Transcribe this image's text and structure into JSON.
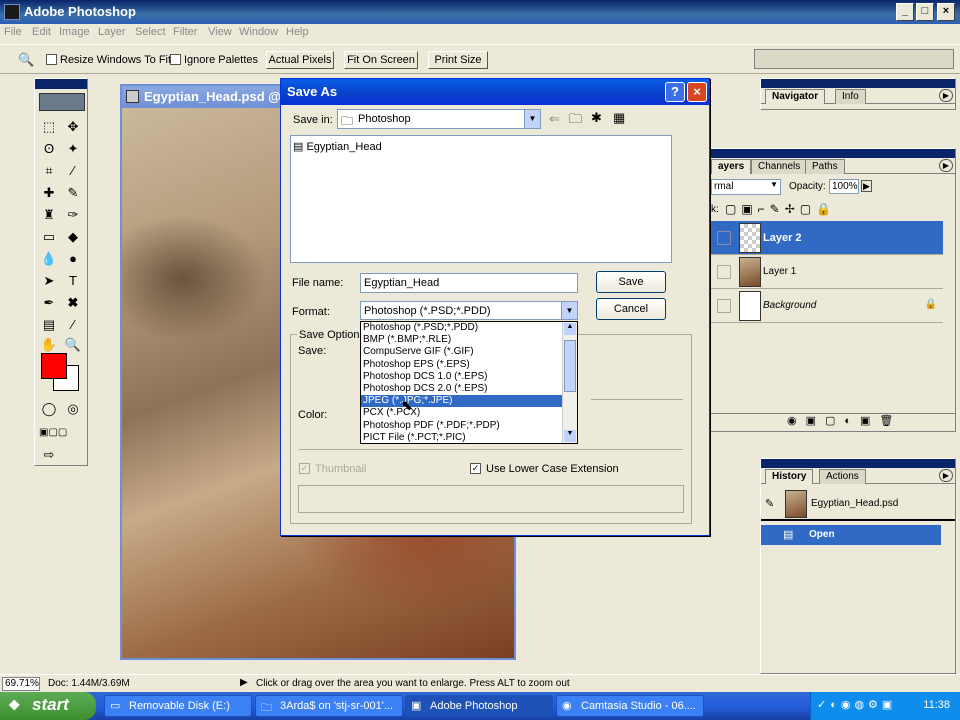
{
  "app": {
    "title": "Adobe Photoshop"
  },
  "menu": [
    "File",
    "Edit",
    "Image",
    "Layer",
    "Select",
    "Filter",
    "View",
    "Window",
    "Help"
  ],
  "options": {
    "resize_label": "Resize Windows To Fit",
    "ignore_label": "Ignore Palettes",
    "actual_pixels": "Actual Pixels",
    "fit_on_screen": "Fit On Screen",
    "print_size": "Print Size"
  },
  "document": {
    "title": "Egyptian_Head.psd @ 6"
  },
  "navigator": {
    "tabs": [
      "Navigator",
      "Info"
    ]
  },
  "layers": {
    "tabs": [
      "ayers",
      "Channels",
      "Paths"
    ],
    "blend_mode": "rmal",
    "opacity_label": "Opacity:",
    "opacity_value": "100%",
    "lock_label": "k:",
    "rows": [
      {
        "name": "Layer 2",
        "selected": true
      },
      {
        "name": "Layer 1",
        "selected": false
      },
      {
        "name": "Background",
        "selected": false
      }
    ]
  },
  "history": {
    "tabs": [
      "History",
      "Actions"
    ],
    "snapshot": "Egyptian_Head.psd",
    "step": "Open"
  },
  "dialog": {
    "title": "Save As",
    "save_in_label": "Save in:",
    "save_in_value": "Photoshop",
    "files": [
      "Egyptian_Head"
    ],
    "filename_label": "File name:",
    "filename_value": "Egyptian_Head",
    "format_label": "Format:",
    "format_value": "Photoshop (*.PSD;*.PDD)",
    "save_button": "Save",
    "cancel_button": "Cancel",
    "save_options_label": "Save Options",
    "save_label": "Save:",
    "color_label": "Color:",
    "thumbnail_label": "Thumbnail",
    "lowercase_label": "Use Lower Case Extension",
    "format_options": [
      "Photoshop (*.PSD;*.PDD)",
      "BMP (*.BMP;*.RLE)",
      "CompuServe GIF (*.GIF)",
      "Photoshop EPS (*.EPS)",
      "Photoshop DCS 1.0 (*.EPS)",
      "Photoshop DCS 2.0 (*.EPS)",
      "JPEG (*.JPG;*.JPE)",
      "PCX (*.PCX)",
      "Photoshop PDF (*.PDF;*.PDP)",
      "PICT File (*.PCT;*.PIC)"
    ],
    "highlighted_option_index": 6
  },
  "status": {
    "zoom": "69.71%",
    "doc": "Doc: 1.44M/3.69M",
    "hint": "Click or drag over the area you want to enlarge. Press ALT to zoom out"
  },
  "taskbar": {
    "start": "start",
    "tasks": [
      "Removable Disk (E:)",
      "3Arda$ on 'stj-sr-001'...",
      "Adobe Photoshop",
      "Camtasia Studio - 06...."
    ],
    "active_index": 2,
    "clock": "11:38"
  },
  "colors": {
    "foreground": "#ff0000",
    "background": "#ffffff",
    "selection": "#316ac5"
  }
}
